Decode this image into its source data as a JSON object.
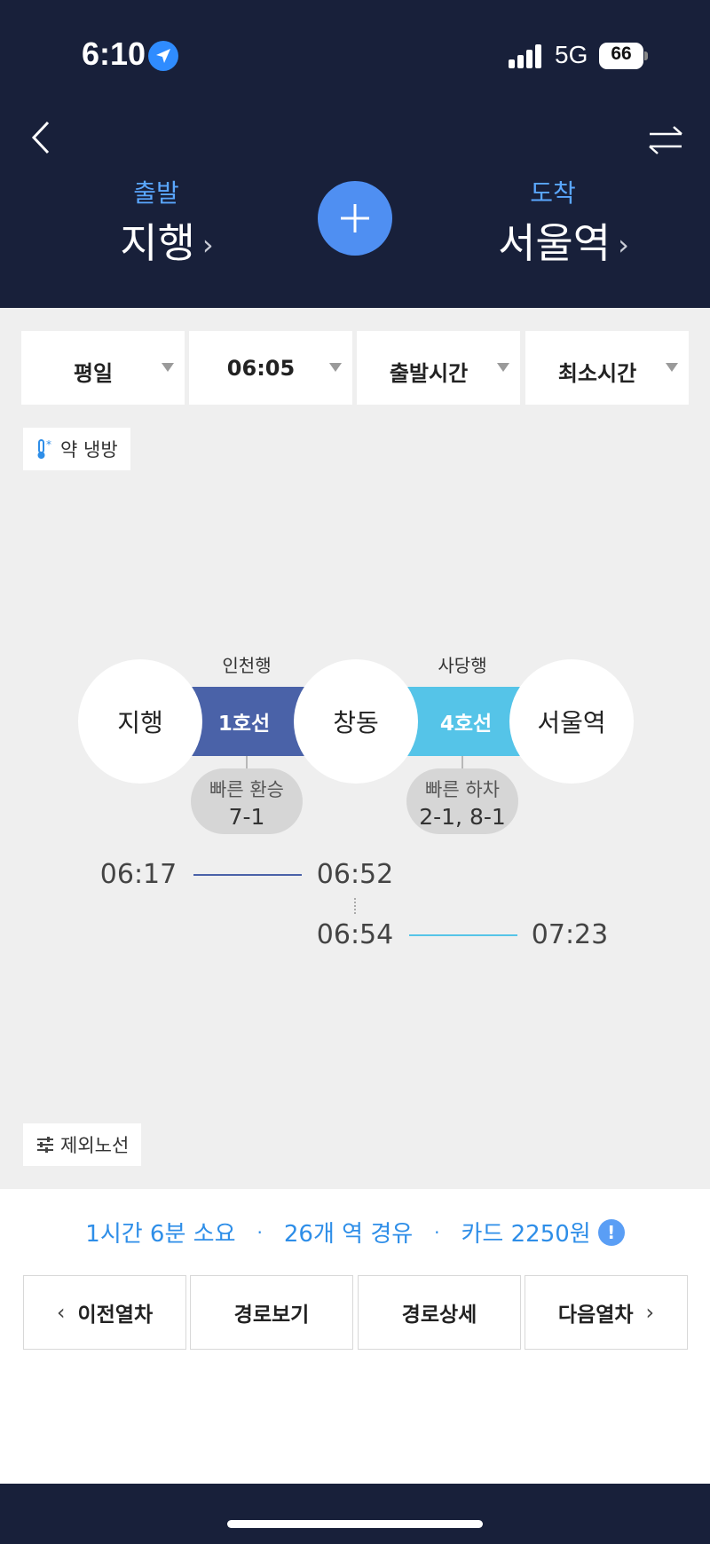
{
  "status_bar": {
    "time": "6:10",
    "network": "5G",
    "battery": "66"
  },
  "header": {
    "origin_label": "출발",
    "origin_name": "지행",
    "dest_label": "도착",
    "dest_name": "서울역",
    "chevron": "›"
  },
  "filters": [
    {
      "label": "평일"
    },
    {
      "label": "06:05"
    },
    {
      "label": "출발시간"
    },
    {
      "label": "최소시간"
    }
  ],
  "aircon_chip": {
    "label": "약 냉방",
    "icon": "thermometer-snowflake-icon"
  },
  "exclude_chip": {
    "label": "제외노선",
    "icon": "sliders-icon"
  },
  "route": {
    "stations": [
      "지행",
      "창동",
      "서울역"
    ],
    "segments": [
      {
        "line": "1호선",
        "direction": "인천행",
        "color": "#4a62a8",
        "depart": "06:17",
        "arrive": "06:52",
        "tip_title": "빠른 환승",
        "tip_value": "7-1"
      },
      {
        "line": "4호선",
        "direction": "사당행",
        "color": "#55c4e8",
        "depart": "06:54",
        "arrive": "07:23",
        "tip_title": "빠른 하차",
        "tip_value": "2-1, 8-1"
      }
    ]
  },
  "summary": {
    "duration": "1시간 6분 소요",
    "stops": "26개 역 경유",
    "fare": "카드 2250원",
    "separator": "·"
  },
  "actions": {
    "prev": "이전열차",
    "route_view": "경로보기",
    "route_detail": "경로상세",
    "next": "다음열차"
  }
}
